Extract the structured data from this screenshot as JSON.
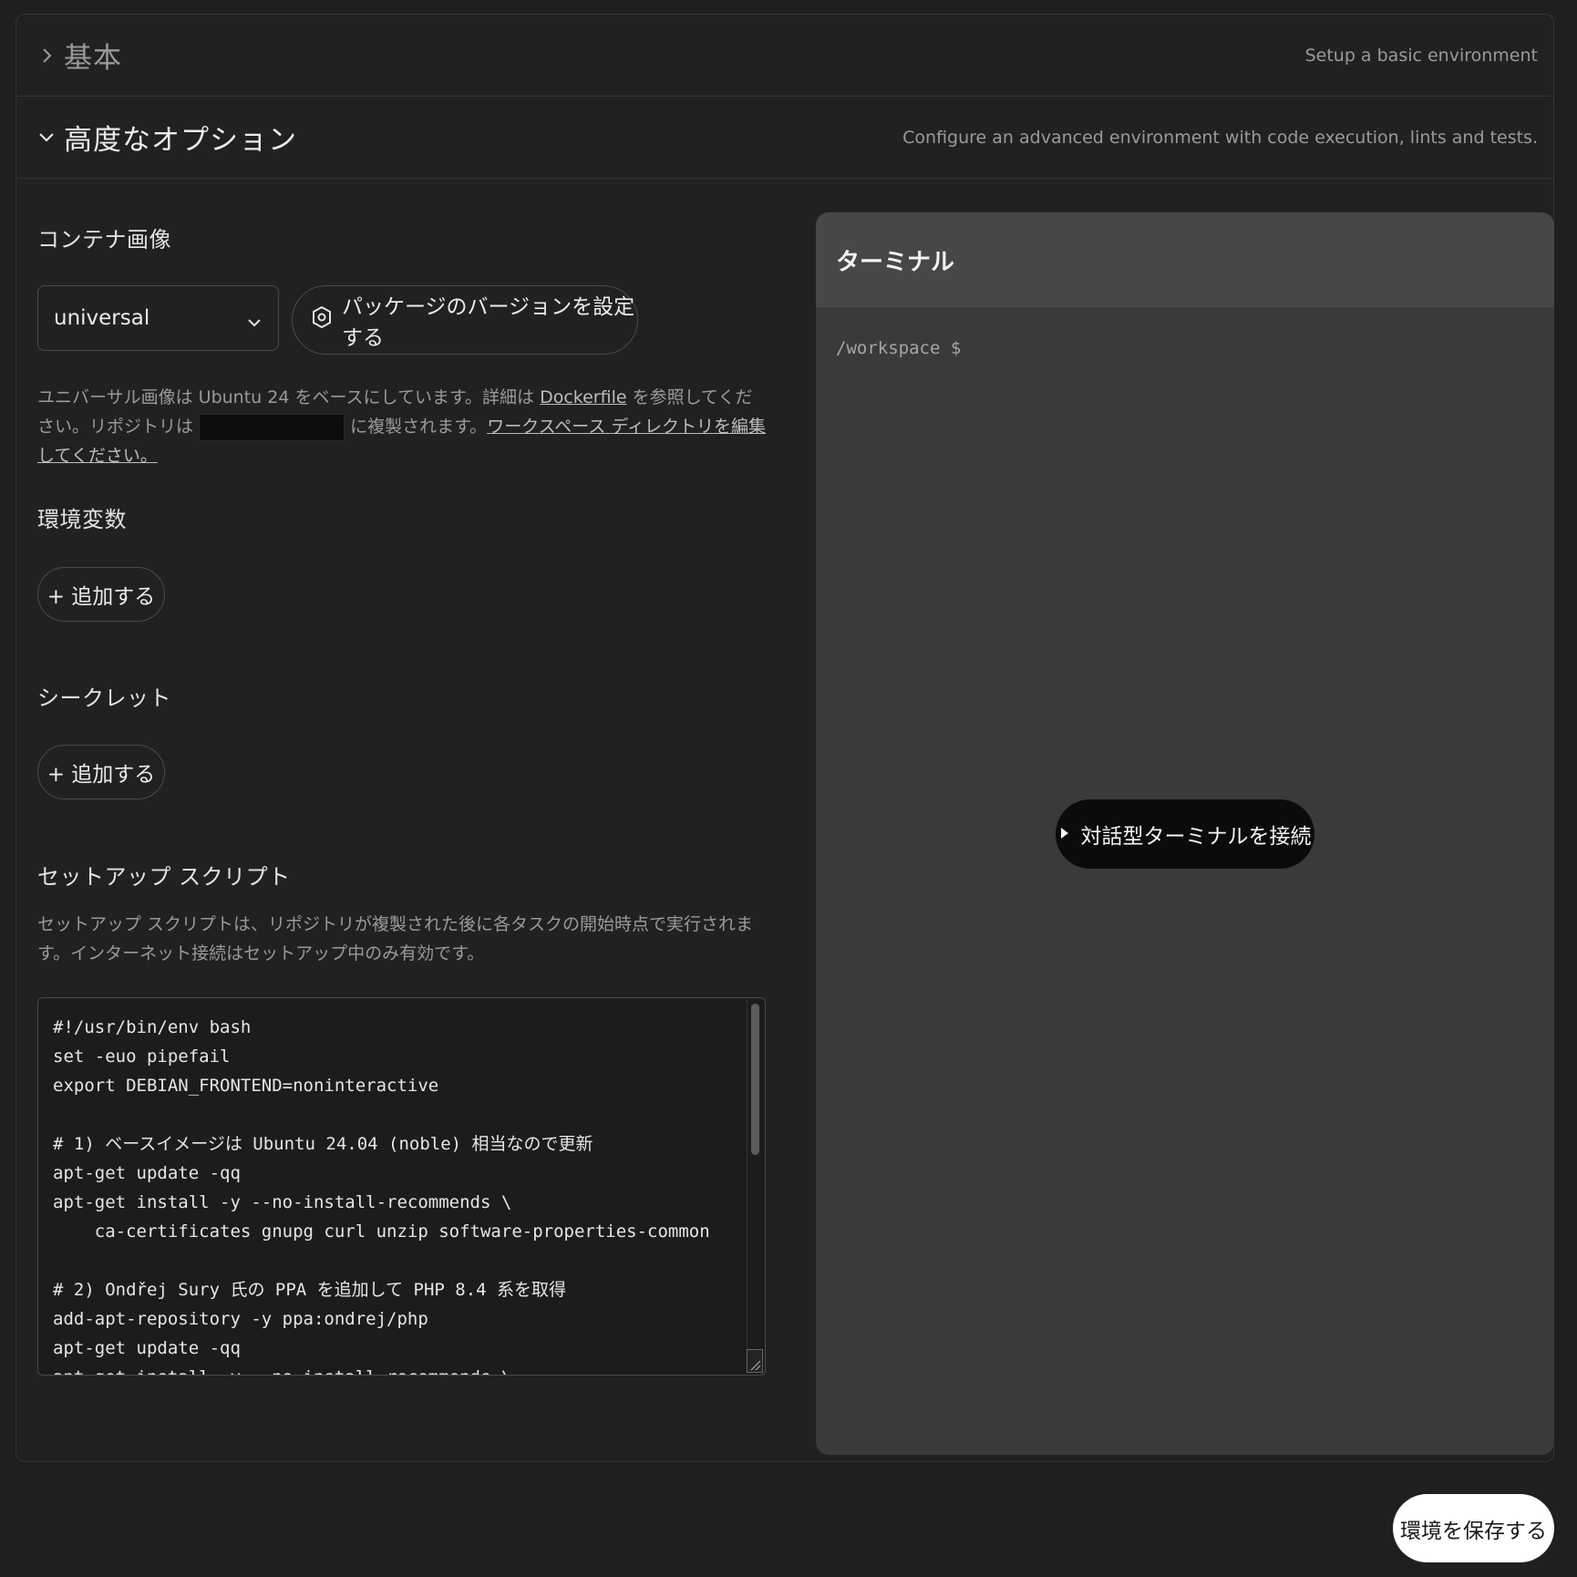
{
  "sections": {
    "basic": {
      "title": "基本",
      "description": "Setup a basic environment",
      "chevron_icon": "chevron-right-icon"
    },
    "advanced": {
      "title": "高度なオプション",
      "description": "Configure an advanced environment with code execution, lints and tests.",
      "chevron_icon": "chevron-down-icon"
    }
  },
  "container": {
    "label": "コンテナ画像",
    "selected_image": "universal",
    "package_button_label": "パッケージのバージョンを設定する",
    "help_part1": "ユニバーサル画像は Ubuntu 24 をベースにしています。詳細は ",
    "dockerfile_link": "Dockerfile",
    "help_part2": " を参照してください。リポジトリは ",
    "help_part3": " に複製されます。",
    "workspace_link": "ワークスペース ディレクトリを編集してください。"
  },
  "env_vars": {
    "label": "環境変数",
    "add_label": "+ 追加する"
  },
  "secrets": {
    "label": "シークレット",
    "add_label": "+ 追加する"
  },
  "setup": {
    "label": "セットアップ スクリプト",
    "help": "セットアップ スクリプトは、リポジトリが複製された後に各タスクの開始時点で実行されます。インターネット接続はセットアップ中のみ有効です。",
    "script": "#!/usr/bin/env bash\nset -euo pipefail\nexport DEBIAN_FRONTEND=noninteractive\n\n# 1) ベースイメージは Ubuntu 24.04 (noble) 相当なので更新\napt-get update -qq\napt-get install -y --no-install-recommends \\\n    ca-certificates gnupg curl unzip software-properties-common\n\n# 2) Ondřej Sury 氏の PPA を追加して PHP 8.4 系を取得\nadd-apt-repository -y ppa:ondrej/php\napt-get update -qq\napt-get install -y --no-install-recommends \\"
  },
  "terminal": {
    "title": "ターミナル",
    "prompt": "/workspace $",
    "connect_label": "対話型ターミナルを接続"
  },
  "save_label": "環境を保存する",
  "colors": {
    "background": "#1f1f1f",
    "panel": "#212121",
    "terminal_bg": "#3a3a3a",
    "terminal_header": "#474747",
    "save_button": "#ffffff"
  }
}
